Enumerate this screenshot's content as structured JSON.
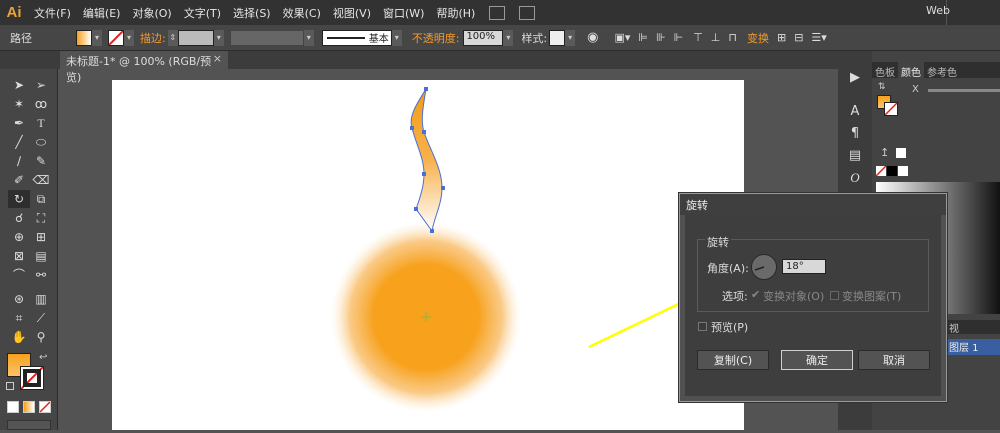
{
  "menubar": {
    "logo": "Ai",
    "items": [
      "文件(F)",
      "编辑(E)",
      "对象(O)",
      "文字(T)",
      "选择(S)",
      "效果(C)",
      "视图(V)",
      "窗口(W)",
      "帮助(H)"
    ],
    "workspace": "Web"
  },
  "control": {
    "path_label": "路径",
    "stroke_label": "描边:",
    "stroke_style": "基本",
    "opacity_label": "不透明度:",
    "opacity_value": "100%",
    "style_label": "样式:",
    "transform_label": "变换"
  },
  "document": {
    "tab_label": "未标题-1* @ 100% (RGB/预览)"
  },
  "right_panel": {
    "tabs": [
      "色板",
      "颜色",
      "参考色"
    ],
    "x_label": "X",
    "layers_tab": "视",
    "layer_name": "图层 1"
  },
  "dialog": {
    "title": "旋转",
    "group_label": "旋转",
    "angle_label": "角度(A):",
    "angle_value": "18°",
    "options_label": "选项:",
    "transform_objects": "变换对象(O)",
    "transform_patterns": "变换图案(T)",
    "preview": "预览(P)",
    "copy": "复制(C)",
    "ok": "确定",
    "cancel": "取消"
  },
  "colors": {
    "accent": "#f29a2e",
    "fill_orange": "#f7a11c",
    "arrow_yellow": "#ffff00"
  },
  "icons": [
    "selection-icon",
    "direct-selection-icon",
    "magic-wand-icon",
    "lasso-icon",
    "pen-icon",
    "type-icon",
    "line-icon",
    "ellipse-icon",
    "brush-icon",
    "pencil-icon",
    "blob-brush-icon",
    "eraser-icon",
    "rotate-icon",
    "scale-icon",
    "warp-icon",
    "free-transform-icon",
    "shape-builder-icon",
    "graph-icon",
    "mesh-icon",
    "gradient-icon",
    "eyedropper-icon",
    "blend-icon",
    "symbol-sprayer-icon",
    "column-graph-icon",
    "artboard-icon",
    "slice-icon",
    "hand-icon",
    "zoom-icon"
  ]
}
